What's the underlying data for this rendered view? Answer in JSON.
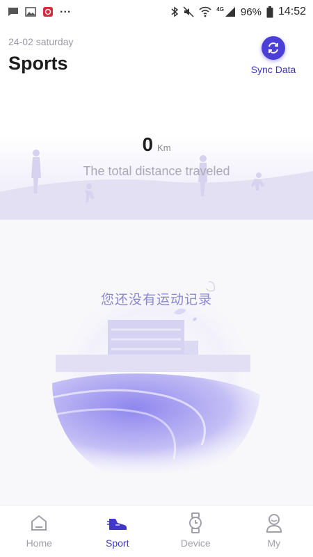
{
  "status_bar": {
    "dots": "...",
    "battery_percent": "96%",
    "network": "4G",
    "time": "14:52"
  },
  "header": {
    "date": "24-02 saturday",
    "title": "Sports",
    "sync_label": "Sync Data"
  },
  "summary": {
    "distance_value": "0",
    "distance_unit": "Km",
    "caption": "The total distance traveled"
  },
  "empty_state": {
    "message": "您还没有运动记录"
  },
  "bottom_nav": {
    "items": [
      {
        "label": "Home",
        "icon": "home-icon",
        "active": false
      },
      {
        "label": "Sport",
        "icon": "sneaker-icon",
        "active": true
      },
      {
        "label": "Device",
        "icon": "watch-icon",
        "active": false
      },
      {
        "label": "My",
        "icon": "person-icon",
        "active": false
      }
    ]
  },
  "colors": {
    "accent": "#4c3fd8",
    "nav_active": "#4036c9",
    "nav_inactive": "#a0a0aa",
    "empty_text": "#8b88d0"
  }
}
